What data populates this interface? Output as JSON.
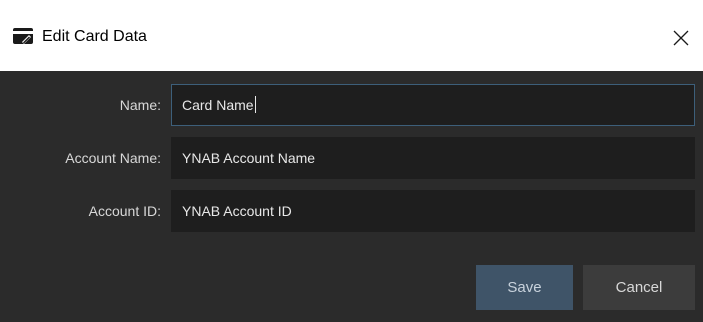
{
  "dialog": {
    "title": "Edit Card Data",
    "icon": "card-edit-icon",
    "close_glyph": "✕"
  },
  "form": {
    "name": {
      "label": "Name:",
      "value": "Card Name"
    },
    "account_name": {
      "label": "Account Name:",
      "value": "YNAB Account Name"
    },
    "account_id": {
      "label": "Account ID:",
      "value": "YNAB Account ID"
    }
  },
  "buttons": {
    "save_label": "Save",
    "cancel_label": "Cancel"
  },
  "colors": {
    "background": "#2b2b2b",
    "field_bg": "#1e1e1e",
    "focus_border": "#3d5f7a",
    "save_bg": "#3f5468",
    "cancel_bg": "#3c3c3c"
  }
}
